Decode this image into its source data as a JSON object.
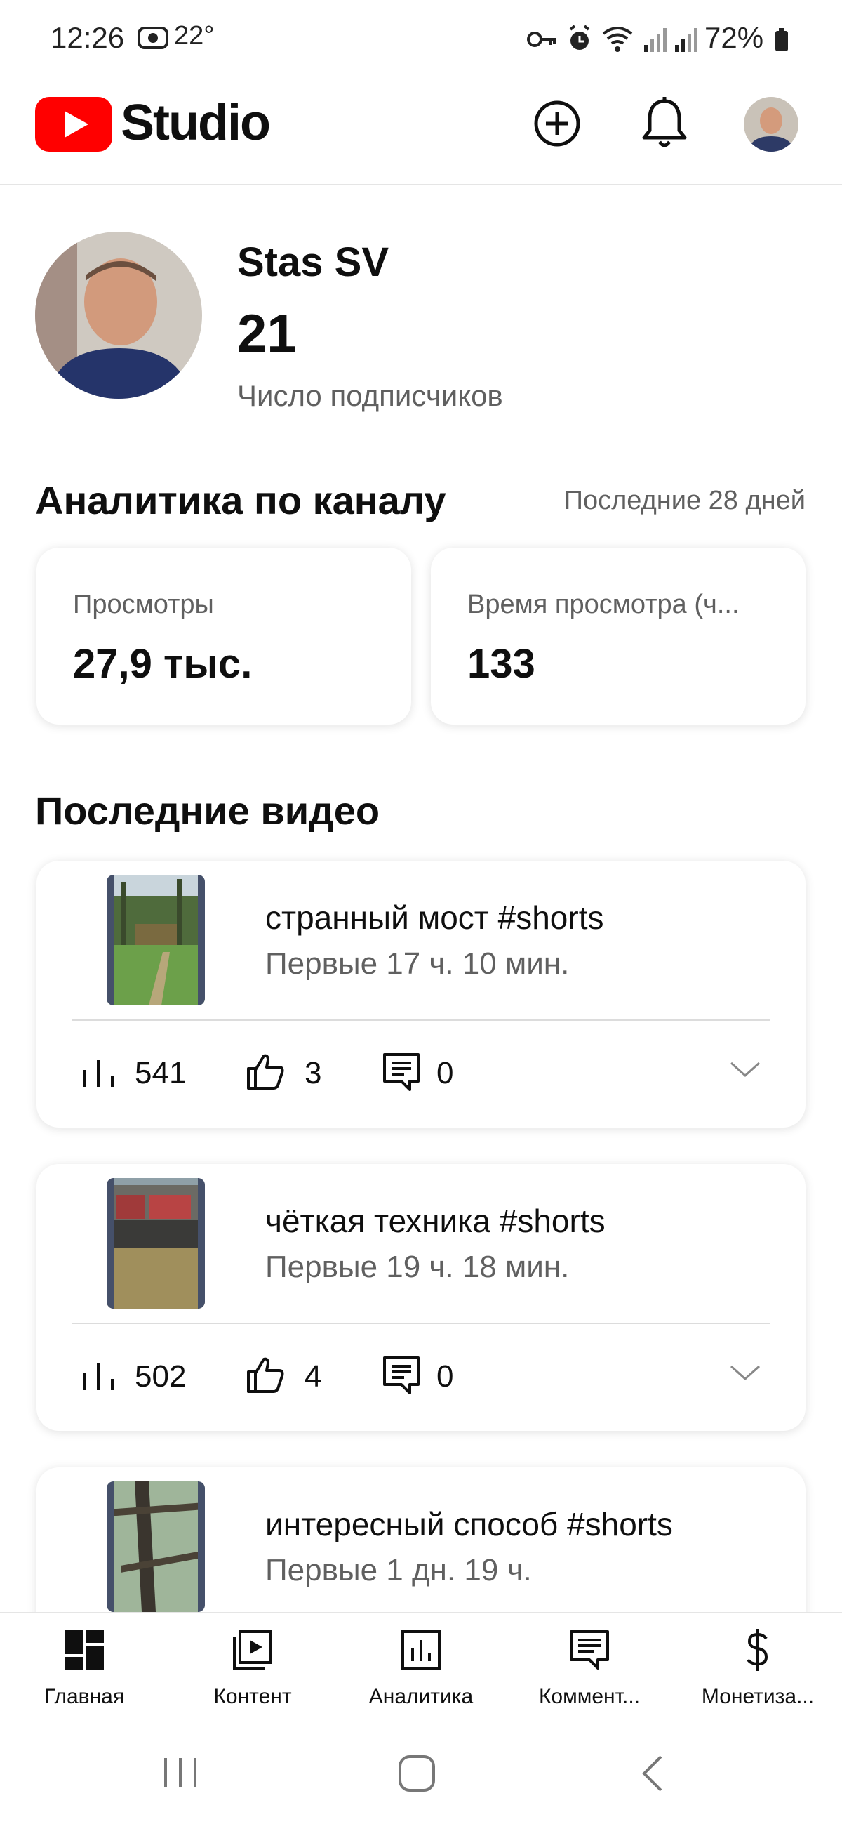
{
  "status_bar": {
    "time": "12:26",
    "temperature": "22°",
    "battery": "72%",
    "icons": [
      "camera-icon",
      "key-icon",
      "alarm-icon",
      "wifi-icon",
      "signal-icon",
      "signal-icon",
      "battery-icon"
    ]
  },
  "app_bar": {
    "title": "Studio",
    "icons": [
      "youtube-logo-icon",
      "create-icon",
      "notifications-icon",
      "account-avatar"
    ]
  },
  "channel": {
    "name": "Stas SV",
    "subscribers": "21",
    "subscribers_label": "Число подписчиков"
  },
  "analytics": {
    "title": "Аналитика по каналу",
    "period": "Последние 28 дней",
    "metrics": [
      {
        "label": "Просмотры",
        "value": "27,9 тыс."
      },
      {
        "label": "Время просмотра (ч...",
        "value": "133"
      }
    ]
  },
  "recent_videos": {
    "title": "Последние видео",
    "items": [
      {
        "title": "странный мост #shorts",
        "time": "Первые 17 ч. 10 мин.",
        "views": "541",
        "likes": "3",
        "comments": "0"
      },
      {
        "title": "чёткая техника #shorts",
        "time": "Первые 19 ч. 18 мин.",
        "views": "502",
        "likes": "4",
        "comments": "0"
      },
      {
        "title": "интересный способ  #shorts",
        "time": "Первые 1 дн. 19 ч."
      }
    ]
  },
  "bottom_nav": {
    "items": [
      {
        "label": "Главная",
        "icon": "dashboard-icon"
      },
      {
        "label": "Контент",
        "icon": "content-icon"
      },
      {
        "label": "Аналитика",
        "icon": "analytics-icon"
      },
      {
        "label": "Коммент...",
        "icon": "comments-icon"
      },
      {
        "label": "Монетиза...",
        "icon": "monetization-icon"
      }
    ]
  },
  "colors": {
    "brand_red": "#ff0000",
    "text_primary": "#0f0f0f",
    "text_secondary": "#606060",
    "divider": "#e5e5e5"
  }
}
